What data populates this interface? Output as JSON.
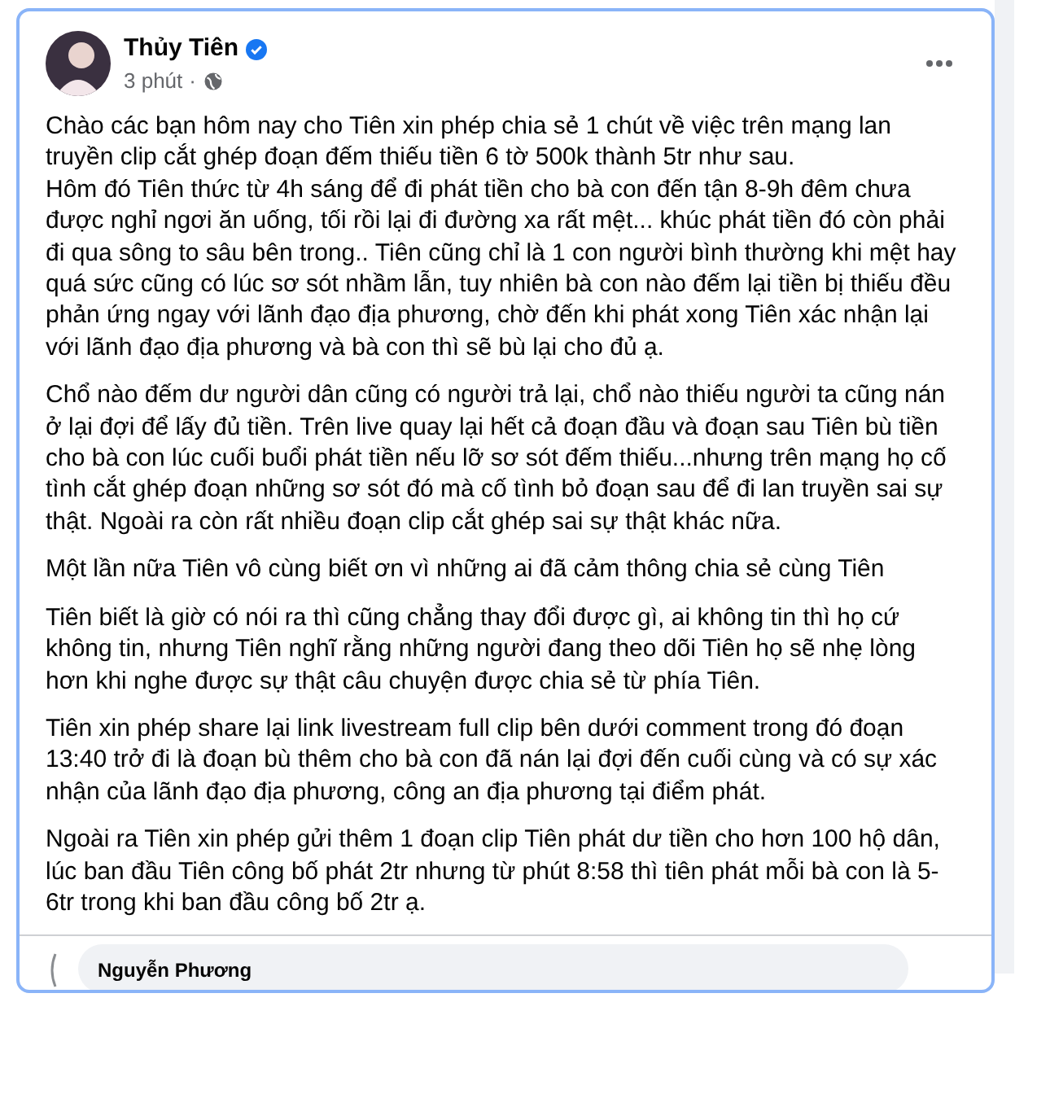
{
  "post": {
    "author": "Thủy Tiên",
    "verified": true,
    "time": "3 phút",
    "separator": "·",
    "paragraphs": [
      "Chào các bạn hôm nay cho Tiên xin phép chia sẻ 1 chút về việc trên mạng lan truyền clip cắt ghép đoạn đếm thiếu tiền 6 tờ 500k thành 5tr như sau.\nHôm đó Tiên thức từ 4h sáng để đi phát tiền cho bà con đến tận 8-9h đêm chưa được nghỉ ngơi ăn uống, tối rồi lại đi đường xa rất mệt... khúc phát tiền đó còn phải đi qua sông to sâu bên trong.. Tiên cũng chỉ là 1 con người bình thường khi mệt hay quá sức cũng có lúc sơ sót nhầm lẫn, tuy nhiên bà con nào đếm lại tiền bị thiếu đều phản ứng ngay với lãnh đạo địa phương, chờ đến khi phát xong Tiên xác nhận lại với lãnh đạo địa phương và bà con thì sẽ bù lại cho đủ ạ.",
      "Chổ nào đếm dư người dân cũng có người trả lại, chổ nào thiếu người ta cũng nán ở lại đợi để lấy đủ tiền. Trên live quay lại hết cả đoạn đầu và đoạn sau Tiên bù tiền cho bà con lúc cuối buổi phát tiền nếu lỡ sơ sót đếm thiếu...nhưng trên mạng họ cố tình cắt ghép đoạn những sơ sót đó mà cố tình bỏ đoạn sau để đi lan truyền sai sự thật. Ngoài ra còn rất nhiều đoạn clip cắt ghép sai sự thật khác nữa.",
      "Một lần nữa Tiên vô cùng biết ơn vì những ai đã cảm thông chia sẻ cùng Tiên",
      "Tiên biết là giờ có nói ra thì cũng chẳng thay đổi được gì, ai không tin thì họ cứ không tin, nhưng Tiên nghĩ rằng những người đang theo dõi Tiên họ sẽ nhẹ lòng hơn khi nghe được sự thật câu chuyện được chia sẻ từ phía Tiên.",
      "Tiên xin phép share lại link livestream full clip bên dưới comment trong đó đoạn 13:40 trở đi là đoạn bù thêm cho bà con đã nán lại đợi đến cuối cùng và có sự xác nhận của lãnh đạo địa phương, công an địa phương tại điểm phát.",
      "Ngoài ra Tiên xin phép gửi thêm 1 đoạn clip Tiên phát dư tiền cho hơn 100 hộ dân, lúc ban đầu Tiên công bố phát 2tr nhưng từ phút 8:58 thì tiên phát mỗi bà con là 5-6tr trong khi ban đầu công bố 2tr ạ."
    ]
  },
  "comment": {
    "author": "Nguyễn Phương"
  }
}
